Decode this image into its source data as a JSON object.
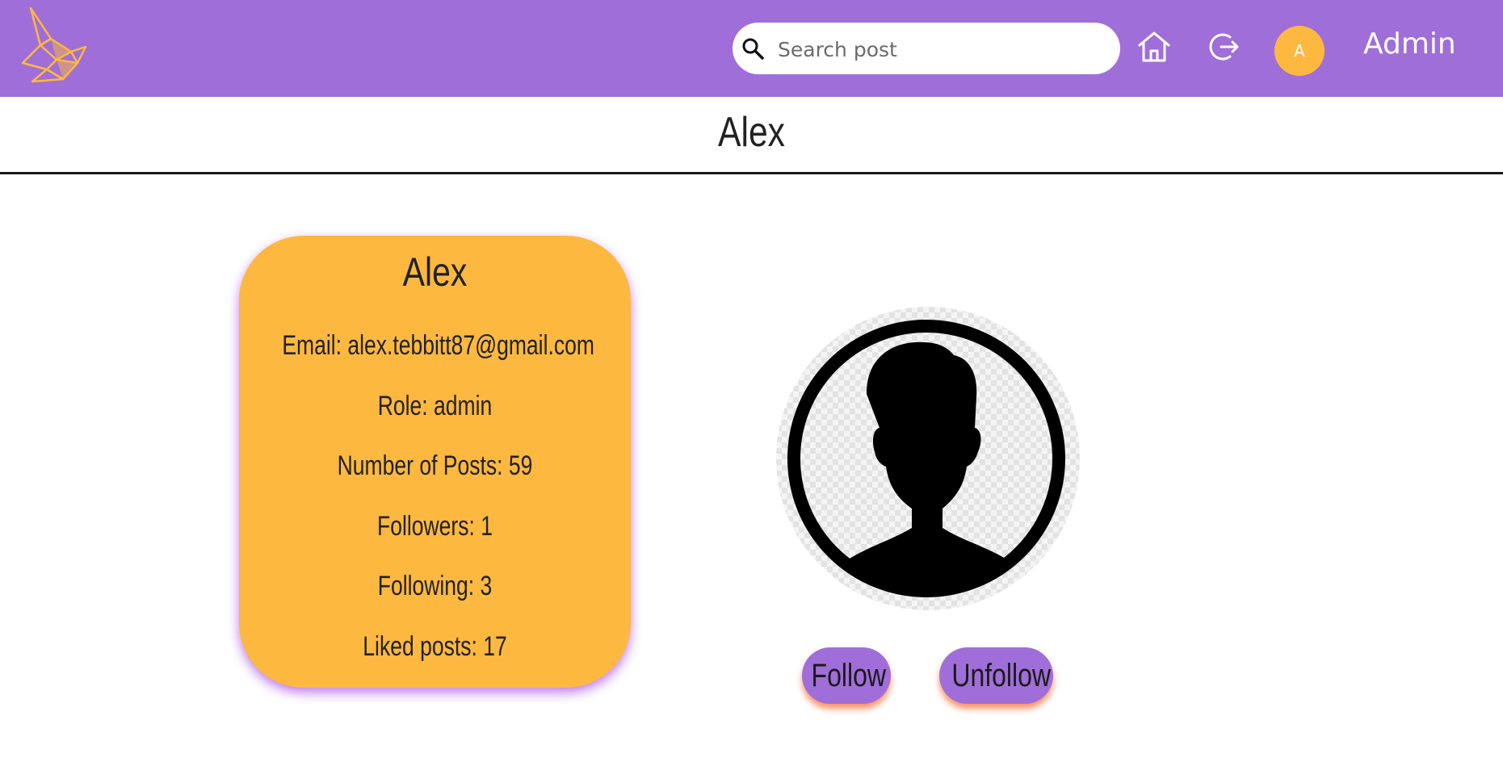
{
  "header": {
    "logo": "origami-bird-logo",
    "search": {
      "placeholder": "Search post",
      "value": ""
    },
    "icons": [
      "search-icon",
      "home-icon",
      "logout-icon"
    ],
    "avatar_letter": "A",
    "user_name": "Admin",
    "colors": {
      "nav_bg": "#a06ed8",
      "accent": "#fdb83f"
    }
  },
  "page": {
    "title": "Alex"
  },
  "profile": {
    "name": "Alex",
    "email_line": "Email: alex.tebbitt87@gmail.com",
    "role_line": "Role: admin",
    "posts_line": "Number of Posts: 59",
    "followers_line": "Followers: 1",
    "following_line": "Following: 3",
    "liked_line": "Liked posts: 17",
    "picture": "default-user-silhouette"
  },
  "actions": {
    "follow_label": "Follow",
    "unfollow_label": "Unfollow"
  }
}
